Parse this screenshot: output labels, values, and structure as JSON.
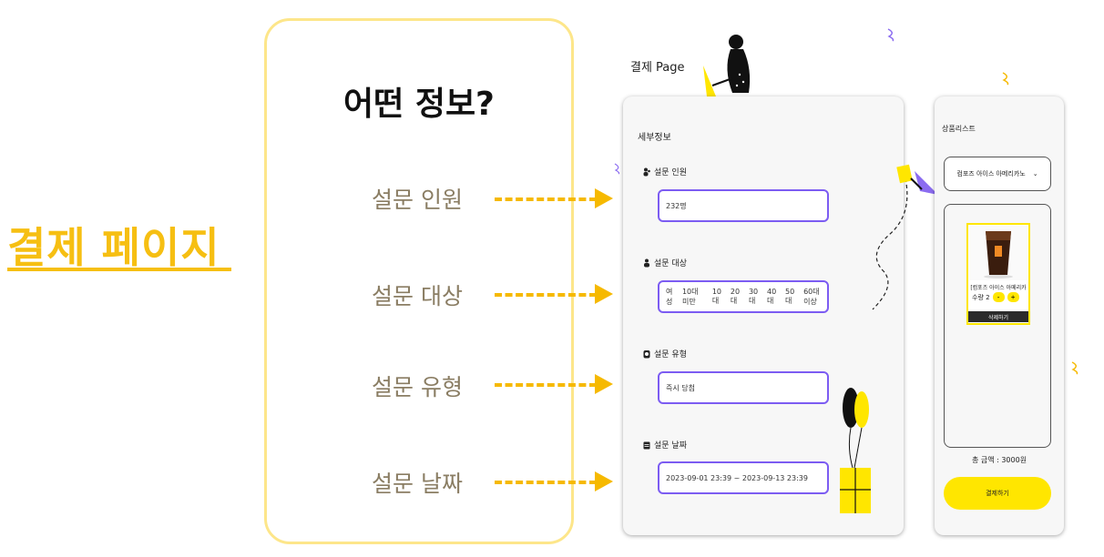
{
  "side_title": "결제 페이지",
  "info_card": {
    "title": "어떤 정보?",
    "labels": [
      "설문 인원",
      "설문 대상",
      "설문 유형",
      "설문 날짜"
    ]
  },
  "payment_page": {
    "caption": "결제 Page",
    "detail_panel": {
      "title": "세부정보",
      "fields": [
        {
          "label": "설문 인원",
          "value": "232명",
          "icon": "people-icon"
        },
        {
          "label": "설문 대상",
          "icon": "person-icon",
          "options": [
            "여성",
            "10대 미만",
            "10대",
            "20대",
            "30대",
            "40대",
            "50대",
            "60대 이상"
          ]
        },
        {
          "label": "설문 유형",
          "value": "즉시 당첨",
          "icon": "clock-icon"
        },
        {
          "label": "설문 날짜",
          "value": "2023-09-01 23:39 ~ 2023-09-13 23:39",
          "icon": "calendar-icon"
        }
      ]
    },
    "product_panel": {
      "title": "상품리스트",
      "select_value": "컴포즈 아이스 아메리카노",
      "item": {
        "name": "[컴포즈 아이스 아메리카노]",
        "qty_label": "수량 2",
        "minus": "-",
        "plus": "+",
        "delete_label": "삭제하기"
      },
      "total": "총 금액 : 3000원",
      "pay_label": "결제하기"
    }
  },
  "colors": {
    "accent_yellow": "#f6bf12",
    "arrow_yellow": "#f6b900",
    "field_border_purple": "#7c5cf2",
    "button_yellow": "#ffe600"
  }
}
